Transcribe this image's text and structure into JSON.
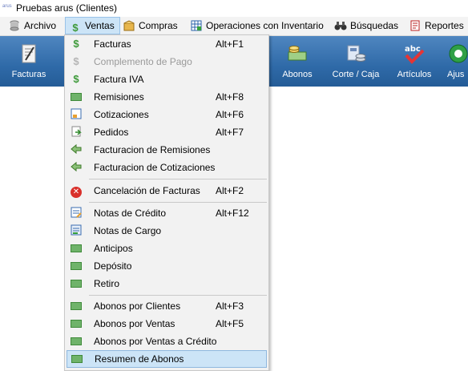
{
  "window": {
    "title": "Pruebas arus (Clientes)",
    "app_icon_text": "arus"
  },
  "menubar": {
    "items": [
      {
        "label": "Archivo",
        "icon": "cylinder-icon"
      },
      {
        "label": "Ventas",
        "icon": "dollar-icon",
        "active": true
      },
      {
        "label": "Compras",
        "icon": "box-icon"
      },
      {
        "label": "Operaciones con Inventario",
        "icon": "grid-icon"
      },
      {
        "label": "Búsquedas",
        "icon": "binoculars-icon"
      },
      {
        "label": "Reportes",
        "icon": "report-icon"
      }
    ]
  },
  "toolbar": {
    "buttons": [
      {
        "label": "Facturas",
        "icon": "invoice-icon"
      },
      {
        "label": "Abonos",
        "icon": "money-icon"
      },
      {
        "label": "Corte / Caja",
        "icon": "cash-register-icon"
      },
      {
        "label": "Artículos",
        "icon": "abc-check-icon"
      },
      {
        "label": "Ajus",
        "icon": "adjust-icon"
      }
    ]
  },
  "ventas_menu": {
    "items": [
      {
        "label": "Facturas",
        "shortcut": "Alt+F1",
        "icon": "dollar-icon"
      },
      {
        "label": "Complemento de Pago",
        "shortcut": "",
        "icon": "dollar-icon",
        "disabled": true
      },
      {
        "label": "Factura IVA",
        "shortcut": "",
        "icon": "dollar-icon"
      },
      {
        "label": "Remisiones",
        "shortcut": "Alt+F8",
        "icon": "money-icon"
      },
      {
        "label": "Cotizaciones",
        "shortcut": "Alt+F6",
        "icon": "document-icon"
      },
      {
        "label": "Pedidos",
        "shortcut": "Alt+F7",
        "icon": "order-icon"
      },
      {
        "label": "Facturacion de Remisiones",
        "shortcut": "",
        "icon": "convert-icon"
      },
      {
        "label": "Facturacion de Cotizaciones",
        "shortcut": "",
        "icon": "convert-icon"
      },
      {
        "label": "Cancelación de Facturas",
        "shortcut": "Alt+F2",
        "icon": "cancel-icon"
      },
      {
        "label": "Notas de Crédito",
        "shortcut": "Alt+F12",
        "icon": "note-icon"
      },
      {
        "label": "Notas de Cargo",
        "shortcut": "",
        "icon": "note-icon"
      },
      {
        "label": "Anticipos",
        "shortcut": "",
        "icon": "money-icon"
      },
      {
        "label": "Depósito",
        "shortcut": "",
        "icon": "money-icon"
      },
      {
        "label": "Retiro",
        "shortcut": "",
        "icon": "money-icon"
      },
      {
        "label": "Abonos por Clientes",
        "shortcut": "Alt+F3",
        "icon": "money-icon"
      },
      {
        "label": "Abonos por Ventas",
        "shortcut": "Alt+F5",
        "icon": "money-icon"
      },
      {
        "label": "Abonos por Ventas a Crédito",
        "shortcut": "",
        "icon": "money-icon"
      },
      {
        "label": "Resumen de Abonos",
        "shortcut": "",
        "icon": "money-icon",
        "highlighted": true
      }
    ]
  }
}
